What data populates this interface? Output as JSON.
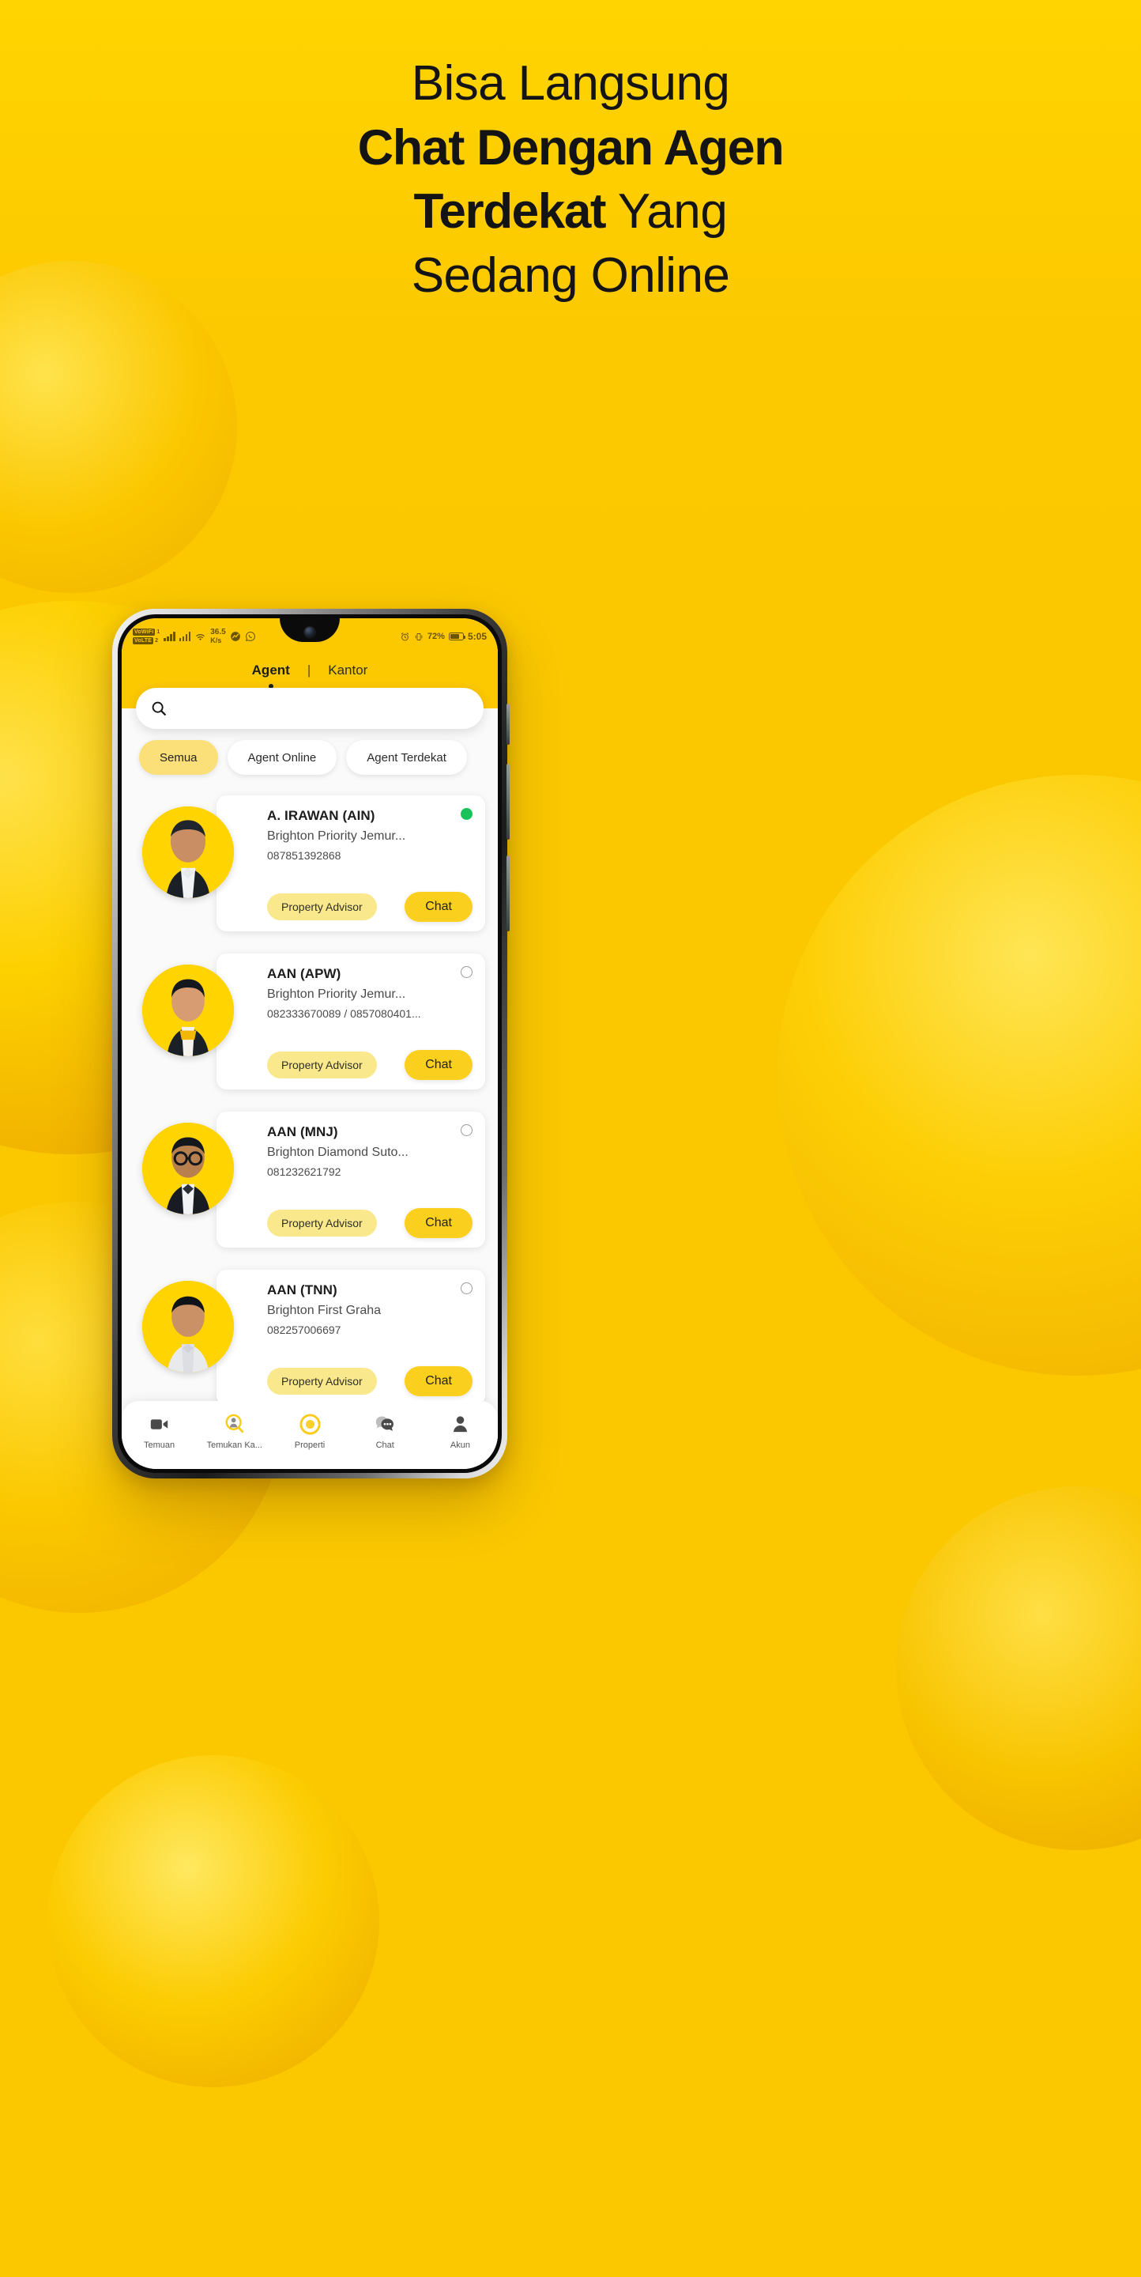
{
  "headline": {
    "line1": "Bisa Langsung",
    "line2": "Chat Dengan Agen",
    "line3_bold": "Terdekat",
    "line3_rest": " Yang",
    "line4": "Sedang Online"
  },
  "colors": {
    "brand_yellow": "#FCC800",
    "accent_yellow": "#FBCF1E",
    "tag_yellow": "#FAE98C",
    "chip_active": "#FBE07A",
    "online_green": "#19C35C",
    "text_dark": "#141414"
  },
  "status_bar": {
    "vowifi_label": "VoWiFi",
    "vowifi_sim": "1",
    "volte_label": "VoLTE",
    "volte_sim": "2",
    "speed_value": "36.5",
    "speed_unit": "K/s",
    "battery_percent": "72%",
    "clock": "5:05",
    "icons": [
      "signal-bars-icon",
      "signal-bars-icon",
      "wifi-icon",
      "data-saver-icon",
      "whatsapp-icon",
      "alarm-clock-icon",
      "vibrate-icon",
      "battery-icon"
    ]
  },
  "app_header": {
    "tabs": [
      {
        "label": "Agent",
        "active": true
      },
      {
        "label": "Kantor",
        "active": false
      }
    ],
    "divider": "|"
  },
  "search": {
    "value": "",
    "placeholder": "",
    "icon": "search-icon"
  },
  "filters": [
    {
      "label": "Semua",
      "active": true
    },
    {
      "label": "Agent Online",
      "active": false
    },
    {
      "label": "Agent Terdekat",
      "active": false
    }
  ],
  "agents": [
    {
      "name": "A. IRAWAN (AIN)",
      "office": "Brighton Priority Jemur...",
      "phone": "087851392868",
      "tag": "Property Advisor",
      "chat_label": "Chat",
      "status": "online"
    },
    {
      "name": "AAN (APW)",
      "office": "Brighton Priority Jemur...",
      "phone": "082333670089 / 0857080401...",
      "tag": "Property Advisor",
      "chat_label": "Chat",
      "status": "offline"
    },
    {
      "name": "AAN (MNJ)",
      "office": "Brighton Diamond Suto...",
      "phone": "081232621792",
      "tag": "Property Advisor",
      "chat_label": "Chat",
      "status": "offline"
    },
    {
      "name": "AAN (TNN)",
      "office": "Brighton First Graha",
      "phone": "082257006697",
      "tag": "Property Advisor",
      "chat_label": "Chat",
      "status": "offline"
    }
  ],
  "bottom_nav": [
    {
      "label": "Temuan",
      "icon": "video-camera-icon",
      "active": false
    },
    {
      "label": "Temukan Ka...",
      "icon": "find-agent-icon",
      "active": true
    },
    {
      "label": "Properti",
      "icon": "property-circle-icon",
      "active": true
    },
    {
      "label": "Chat",
      "icon": "chat-bubbles-icon",
      "active": false
    },
    {
      "label": "Akun",
      "icon": "person-icon",
      "active": false
    }
  ]
}
